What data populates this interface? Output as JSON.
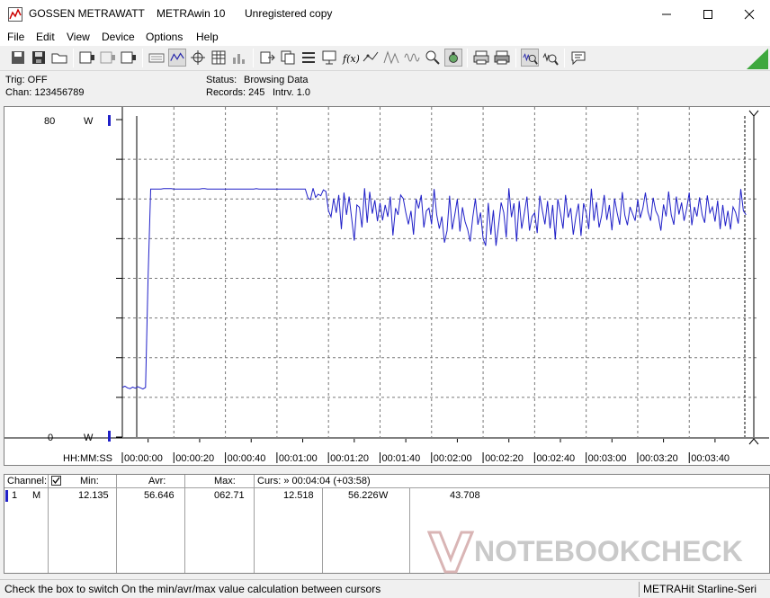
{
  "titlebar": {
    "brand": "GOSSEN METRAWATT",
    "app": "METRAwin 10",
    "registration": "Unregistered copy"
  },
  "menu": [
    "File",
    "Edit",
    "View",
    "Device",
    "Options",
    "Help"
  ],
  "info": {
    "trig": "Trig: OFF",
    "chan": "Chan:  123456789",
    "status_label": "Status:",
    "status_value": "Browsing Data",
    "records": "Records: 245",
    "interval": "Intrv. 1.0"
  },
  "chart": {
    "y_top_label": "80",
    "y_bottom_label": "0",
    "unit": "W",
    "time_header": "HH:MM:SS"
  },
  "chart_data": {
    "type": "line",
    "ylabel": "W",
    "xlabel": "HH:MM:SS",
    "ylim": [
      0,
      80
    ],
    "xlim_seconds": [
      0,
      244
    ],
    "x_tick_labels": [
      "00:00:00",
      "00:00:20",
      "00:00:40",
      "00:01:00",
      "00:01:20",
      "00:01:40",
      "00:02:00",
      "00:02:20",
      "00:02:40",
      "00:03:00",
      "00:03:20",
      "00:03:40"
    ],
    "grid": true,
    "series": [
      {
        "color": "#2020c8",
        "values": [
          12.5,
          12.8,
          12.4,
          12.2,
          12.6,
          12.3,
          12.7,
          12.4,
          12.1,
          12.5,
          40,
          62.5,
          62.5,
          62.5,
          62.5,
          62.5,
          62.6,
          62.6,
          62.6,
          62.6,
          62.5,
          62.5,
          62.5,
          62.5,
          62.5,
          62.5,
          62.5,
          62.5,
          62.5,
          62.5,
          62.5,
          62.6,
          62.6,
          62.5,
          62.5,
          62.5,
          62.5,
          62.5,
          62.5,
          62.5,
          62.5,
          62.5,
          62.5,
          62.5,
          62.5,
          62.5,
          62.5,
          62.5,
          62.5,
          62.5,
          62.5,
          62.5,
          62.6,
          62.5,
          62.5,
          62.5,
          62.5,
          62.5,
          62.5,
          62.5,
          62.5,
          62.5,
          62.5,
          62.5,
          62.5,
          62.5,
          62.5,
          62.5,
          62.5,
          62.5,
          62.5,
          62.5,
          60.3,
          59.8,
          62.7,
          60.4,
          61.2,
          60.8,
          62.3,
          61.9,
          57.0,
          55.5,
          60.1,
          56.5,
          61.0,
          52.4,
          61.6,
          56.0,
          60.6,
          55.0,
          49.5,
          58.5,
          57.9,
          52.8,
          62.7,
          54.0,
          61.8,
          56.3,
          59.7,
          54.4,
          59.0,
          54.6,
          58.5,
          55.5,
          60.6,
          50.8,
          57.7,
          56.0,
          61.0,
          60.1,
          56.6,
          53.6,
          57.0,
          51.0,
          60.0,
          57.6,
          61.0,
          52.8,
          57.0,
          57.7,
          53.6,
          62.5,
          56.0,
          52.5,
          55.6,
          49.0,
          52.0,
          60.8,
          52.3,
          56.0,
          60.0,
          51.8,
          57.9,
          54.3,
          52.3,
          49.3,
          55.4,
          60.1,
          53.5,
          56.6,
          50.0,
          48.2,
          59.0,
          51.0,
          57.2,
          48.2,
          53.4,
          59.1,
          56.6,
          50.3,
          62.7,
          55.4,
          58.9,
          49.3,
          59.5,
          52.5,
          56.4,
          60.6,
          52.0,
          55.6,
          56.5,
          51.4,
          60.8,
          57.0,
          53.6,
          59.5,
          52.6,
          58.5,
          49.8,
          60.0,
          56.5,
          52.5,
          61.0,
          55.3,
          57.7,
          51.0,
          55.5,
          58.8,
          50.7,
          58.9,
          56.5,
          52.4,
          62.6,
          54.5,
          59.2,
          52.8,
          55.8,
          61.0,
          54.7,
          58.5,
          52.1,
          60.1,
          56.6,
          53.5,
          61.7,
          55.9,
          53.4,
          58.0,
          56.3,
          54.5,
          59.9,
          55.2,
          57.7,
          61.6,
          56.7,
          54.5,
          60.3,
          57.0,
          55.6,
          52.0,
          58.6,
          55.6,
          61.9,
          56.0,
          53.5,
          60.6,
          56.1,
          59.1,
          54.5,
          57.6,
          61.6,
          53.4,
          58.0,
          55.6,
          60.4,
          56.0,
          54.0,
          60.9,
          56.5,
          58.0,
          54.3,
          59.6,
          52.4,
          58.5,
          53.2,
          57.0,
          52.3,
          58.0,
          56.6,
          53.8,
          62.5,
          57.0,
          56.0
        ]
      }
    ]
  },
  "table": {
    "headers": {
      "channel": "Channel:",
      "min": "Min:",
      "avr": "Avr:",
      "max": "Max:",
      "curs": "Curs: » 00:04:04 (+03:58)"
    },
    "row": {
      "index": "1",
      "mode": "M",
      "min": "12.135",
      "avr": "56.646",
      "max": "062.71",
      "cursor1": "12.518",
      "cursor2": "56.226",
      "unit": "W",
      "delta": "43.708"
    }
  },
  "status": {
    "message": "Check the box to switch On the min/avr/max value calculation between cursors",
    "device": "METRAHit Starline-Seri"
  },
  "watermark": "NOTEBOOKCHECK"
}
